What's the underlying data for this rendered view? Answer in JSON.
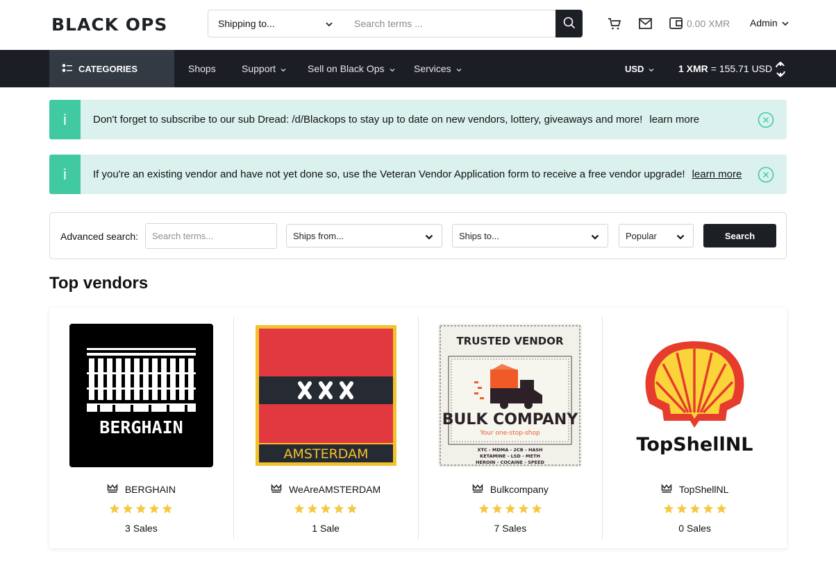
{
  "header": {
    "logo_text": "BLACK OPS",
    "shipping_select": "Shipping to...",
    "search_placeholder": "Search terms ...",
    "wallet_balance": "0.00 XMR",
    "user_menu": "Admin",
    "icons": [
      "cart-icon",
      "mail-icon",
      "wallet-icon",
      "search-icon"
    ]
  },
  "nav": {
    "categories_label": "CATEGORIES",
    "items": [
      {
        "label": "Shops",
        "dropdown": false
      },
      {
        "label": "Support",
        "dropdown": true
      },
      {
        "label": "Sell on Black Ops",
        "dropdown": true
      },
      {
        "label": "Services",
        "dropdown": true
      }
    ],
    "currency": "USD",
    "rate_prefix": "1 XMR",
    "rate_value": "= 155.71 USD"
  },
  "alerts": [
    {
      "icon": "i",
      "message": "Don't forget to subscribe to our sub Dread: /d/Blackops to stay up to date on new vendors, lottery, giveaways and more!",
      "link": "learn more"
    },
    {
      "icon": "i",
      "message": "If you're an existing vendor and have not yet done so, use the Veteran Vendor Application form to receive a free vendor upgrade!",
      "link": "learn more"
    }
  ],
  "advanced_search": {
    "label": "Advanced search:",
    "terms_placeholder": "Search terms...",
    "ships_from": "Ships from...",
    "ships_to": "Ships to...",
    "sort": "Popular",
    "button": "Search"
  },
  "top_vendors": {
    "title": "Top vendors",
    "vendors": [
      {
        "name": "BERGHAIN",
        "rating": 5,
        "sales": "3 Sales",
        "image_text": "BERGHAIN"
      },
      {
        "name": "WeAreAMSTERDAM",
        "rating": 5,
        "sales": "1 Sale",
        "image_text": "AMSTERDAM"
      },
      {
        "name": "Bulkcompany",
        "rating": 5,
        "sales": "7 Sales",
        "image_text": {
          "top": "TRUSTED VENDOR",
          "brand": "BULK COMPANY",
          "tagline": "Your one-stop-shop",
          "line1": "XTC - MDMA - 2CB - HASH",
          "line2": "KETAMINE - LSD - METH",
          "line3": "HEROIN - COCAINE - SPEED"
        }
      },
      {
        "name": "TopShellNL",
        "rating": 5,
        "sales": "0 Sales",
        "image_text": "TopShellNL"
      }
    ]
  },
  "colors": {
    "navbar": "#1b1e25",
    "categories_bg": "#343a43",
    "alert_bg": "#daf1ee",
    "alert_accent": "#41c9a2",
    "star": "#f5c842",
    "button_dark": "#1c1f23"
  }
}
